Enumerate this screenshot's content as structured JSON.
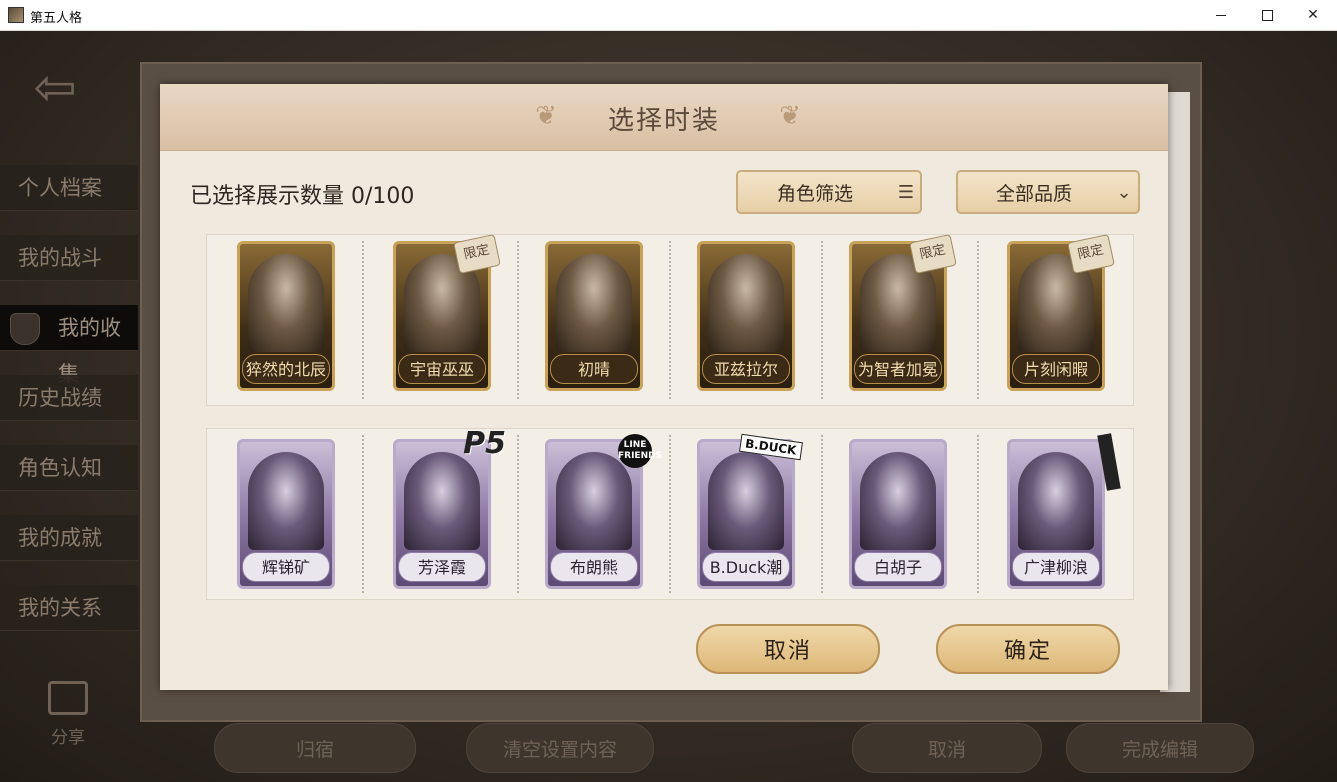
{
  "window": {
    "title": "第五人格",
    "minimize_icon": "minimize-icon",
    "maximize_icon": "maximize-icon",
    "close_icon": "close-icon"
  },
  "background": {
    "sidebar": [
      "个人档案",
      "我的战斗",
      "我的收集",
      "历史战绩",
      "角色认知",
      "我的成就",
      "我的关系"
    ],
    "share_label": "分享",
    "bottom_buttons": [
      "归宿",
      "清空设置内容",
      "取消",
      "完成编辑"
    ]
  },
  "modal": {
    "title": "选择时装",
    "count_label": "已选择展示数量 0/100",
    "role_filter": "角色筛选",
    "quality_filter": "全部品质",
    "row1": [
      {
        "name": "猝然的北辰",
        "tag": ""
      },
      {
        "name": "宇宙巫巫",
        "tag": "限定"
      },
      {
        "name": "初晴",
        "tag": ""
      },
      {
        "name": "亚兹拉尔",
        "tag": ""
      },
      {
        "name": "为智者加冕",
        "tag": "限定"
      },
      {
        "name": "片刻闲暇",
        "tag": "限定"
      }
    ],
    "row2": [
      {
        "name": "辉锑矿",
        "collab": ""
      },
      {
        "name": "芳泽霞",
        "collab": "P5"
      },
      {
        "name": "布朗熊",
        "collab": "LINE FRIENDS"
      },
      {
        "name": "B.Duck潮",
        "collab": "B.DUCK"
      },
      {
        "name": "白胡子",
        "collab": ""
      },
      {
        "name": "广津柳浪",
        "collab": ""
      }
    ],
    "cancel": "取消",
    "confirm": "确定"
  }
}
